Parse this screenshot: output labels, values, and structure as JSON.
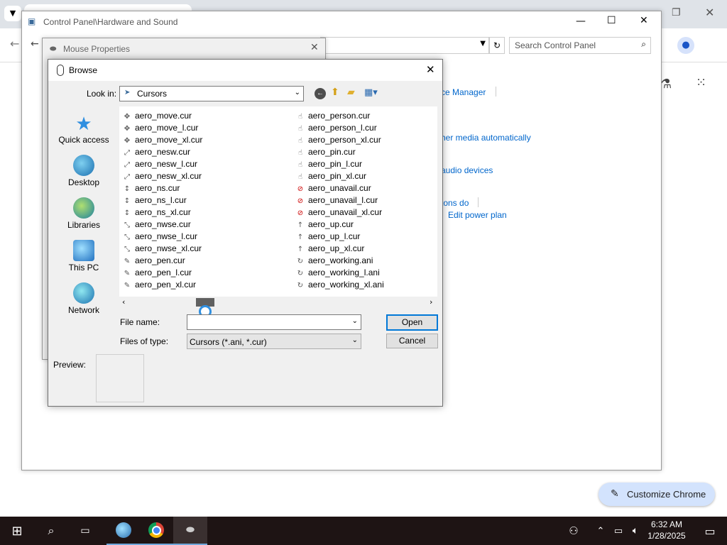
{
  "chrome": {
    "customize_label": "Customize Chrome"
  },
  "control_panel": {
    "title": "Control Panel\\Hardware and Sound",
    "search_placeholder": "Search Control Panel",
    "links": [
      "ce Manager",
      "her media automatically",
      "audio devices",
      "tons do",
      "Edit power plan"
    ]
  },
  "mouse_properties": {
    "title": "Mouse Properties"
  },
  "browse": {
    "title": "Browse",
    "look_in_label": "Look in:",
    "look_in_value": "Cursors",
    "places": [
      "Quick access",
      "Desktop",
      "Libraries",
      "This PC",
      "Network"
    ],
    "files_col1": [
      "aero_move.cur",
      "aero_move_l.cur",
      "aero_move_xl.cur",
      "aero_nesw.cur",
      "aero_nesw_l.cur",
      "aero_nesw_xl.cur",
      "aero_ns.cur",
      "aero_ns_l.cur",
      "aero_ns_xl.cur",
      "aero_nwse.cur",
      "aero_nwse_l.cur",
      "aero_nwse_xl.cur",
      "aero_pen.cur",
      "aero_pen_l.cur",
      "aero_pen_xl.cur"
    ],
    "files_col2": [
      "aero_person.cur",
      "aero_person_l.cur",
      "aero_person_xl.cur",
      "aero_pin.cur",
      "aero_pin_l.cur",
      "aero_pin_xl.cur",
      "aero_unavail.cur",
      "aero_unavail_l.cur",
      "aero_unavail_xl.cur",
      "aero_up.cur",
      "aero_up_l.cur",
      "aero_up_xl.cur",
      "aero_working.ani",
      "aero_working_l.ani",
      "aero_working_xl.ani"
    ],
    "file_name_label": "File name:",
    "file_name_value": "",
    "files_of_type_label": "Files of type:",
    "files_of_type_value": "Cursors (*.ani, *.cur)",
    "open_label": "Open",
    "cancel_label": "Cancel",
    "preview_label": "Preview:"
  },
  "taskbar": {
    "time": "6:32 AM",
    "date": "1/28/2025"
  },
  "colors": {
    "accent": "#0066cc",
    "taskbar": "#1e1414",
    "unavail": "#cc0000"
  }
}
